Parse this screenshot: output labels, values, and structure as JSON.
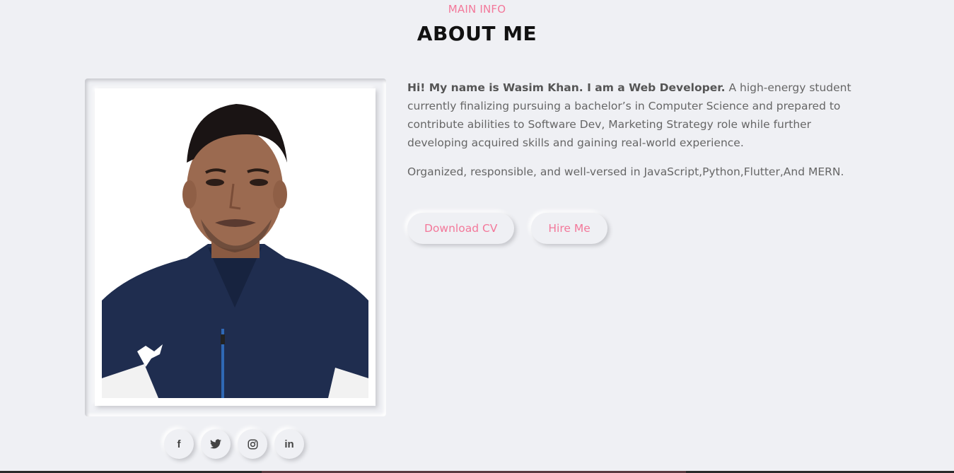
{
  "header": {
    "subtitle": "MAIN INFO",
    "title": "ABOUT ME"
  },
  "profile": {
    "photo_alt": "Portrait of Wasim Khan"
  },
  "socials": [
    {
      "icon": "facebook-icon",
      "glyph": "f"
    },
    {
      "icon": "twitter-icon",
      "glyph": "🐦"
    },
    {
      "icon": "instagram-icon",
      "glyph": "◎"
    },
    {
      "icon": "linkedin-icon",
      "glyph": "in"
    }
  ],
  "bio": {
    "intro_bold": "Hi! My name is Wasim Khan. I am a Web Developer.",
    "intro_rest": " A high-energy student currently finalizing pursuing a bachelor’s in Computer Science and prepared to contribute abilities to Software Dev, Marketing Strategy role while further developing acquired skills and gaining real-world experience.",
    "skills": "Organized, responsible, and well-versed in JavaScript,Python,Flutter,And MERN."
  },
  "actions": {
    "download_cv": "Download CV",
    "hire_me": "Hire Me"
  },
  "colors": {
    "accent": "#f3789a",
    "background": "#eff0f4",
    "heading": "#111111",
    "text": "#666666"
  }
}
